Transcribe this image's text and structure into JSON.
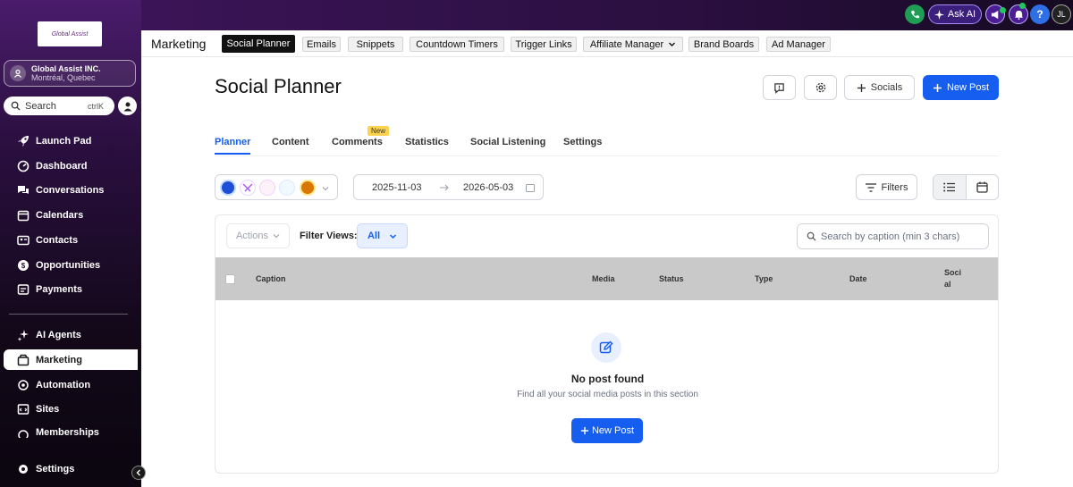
{
  "sidebar": {
    "logo_text": "Global Assist",
    "account": {
      "name": "Global Assist INC.",
      "location": "Montréal, Quebec"
    },
    "search": {
      "label": "Search",
      "shortcut": "ctrlK"
    },
    "items": [
      {
        "label": "Launch Pad",
        "icon": "rocket-icon"
      },
      {
        "label": "Dashboard",
        "icon": "dashboard-icon"
      },
      {
        "label": "Conversations",
        "icon": "chat-icon"
      },
      {
        "label": "Calendars",
        "icon": "calendar-icon"
      },
      {
        "label": "Contacts",
        "icon": "contacts-icon"
      },
      {
        "label": "Opportunities",
        "icon": "opportunities-icon"
      },
      {
        "label": "Payments",
        "icon": "payments-icon"
      },
      {
        "label": "AI Agents",
        "icon": "sparkle-icon"
      },
      {
        "label": "Marketing",
        "icon": "marketing-icon"
      },
      {
        "label": "Automation",
        "icon": "automation-icon"
      },
      {
        "label": "Sites",
        "icon": "sites-icon"
      },
      {
        "label": "Memberships",
        "icon": "memberships-icon"
      }
    ],
    "settings_label": "Settings"
  },
  "topbar": {
    "ask_ai": "Ask AI",
    "help": "?",
    "avatar_initials": "JL"
  },
  "module": {
    "title": "Marketing",
    "tabs": [
      "Social Planner",
      "Emails",
      "Snippets",
      "Countdown Timers",
      "Trigger Links",
      "Affiliate Manager",
      "Brand Boards",
      "Ad Manager"
    ]
  },
  "page": {
    "title": "Social Planner",
    "socials_label": "Socials",
    "new_post_label": "New Post"
  },
  "subtabs": [
    "Planner",
    "Content",
    "Comments",
    "Statistics",
    "Social Listening",
    "Settings"
  ],
  "new_badge": "New",
  "filters": {
    "start_date": "2025-11-03",
    "end_date": "2026-05-03",
    "filters_label": "Filters"
  },
  "table": {
    "actions_label": "Actions",
    "filter_views_label": "Filter Views:",
    "filter_view_value": "All",
    "search_placeholder": "Search by caption (min 3 chars)",
    "columns": [
      "Caption",
      "Media",
      "Status",
      "Type",
      "Date",
      "Soci al"
    ],
    "empty_title": "No post found",
    "empty_subtitle": "Find all your social media posts in this section",
    "empty_button": "New Post"
  },
  "colors": {
    "primary": "#155eef",
    "sidebar_bg": "#2a0f3f",
    "active_tab": "#111111"
  }
}
